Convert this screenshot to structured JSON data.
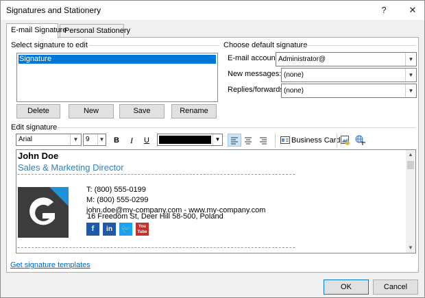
{
  "window": {
    "title": "Signatures and Stationery"
  },
  "titlebar": {
    "help_label": "?",
    "close_label": "✕"
  },
  "tabs": [
    {
      "label": "E-mail Signature",
      "active": true
    },
    {
      "label": "Personal Stationery",
      "active": false
    }
  ],
  "select_signature": {
    "label": "Select signature to edit",
    "items": [
      "Signature"
    ],
    "selected": "Signature"
  },
  "signature_buttons": {
    "delete": "Delete",
    "new": "New",
    "save": "Save",
    "rename": "Rename"
  },
  "default_signature": {
    "heading": "Choose default signature",
    "email_account_label": "E-mail account:",
    "email_account_value": "Administrator@",
    "new_messages_label": "New messages:",
    "new_messages_value": "(none)",
    "replies_label": "Replies/forwards:",
    "replies_value": "(none)"
  },
  "edit_signature": {
    "label": "Edit signature",
    "font_value": "Arial",
    "size_value": "9",
    "bold": "B",
    "italic": "I",
    "underline": "U",
    "font_color": "#000000",
    "business_card_label": "Business Card"
  },
  "signature_content": {
    "name": "John Doe",
    "title": "Sales & Marketing Director",
    "phone": "T: (800) 555-0199",
    "mobile": "M: (800) 555-0299",
    "email_web": "john.doe@my-company.com - www.my-company.com",
    "address": "16 Freedom St, Deer Hill 58-500, Poland",
    "social": [
      {
        "icon": "facebook-icon",
        "glyph": "f",
        "color": "#1e5aa8"
      },
      {
        "icon": "linkedin-icon",
        "glyph": "in",
        "color": "#1e5aa8"
      },
      {
        "icon": "twitter-icon",
        "glyph": "t",
        "color": "#1da1f2"
      },
      {
        "icon": "youtube-icon",
        "glyph": "You\nTube",
        "color": "#c4302b"
      }
    ],
    "logo_colors": {
      "background": "#3c3c3c",
      "accent": "#1e90d8"
    },
    "title_color": "#2e7fc1"
  },
  "templates_link": "Get signature templates",
  "footer": {
    "ok": "OK",
    "cancel": "Cancel"
  }
}
